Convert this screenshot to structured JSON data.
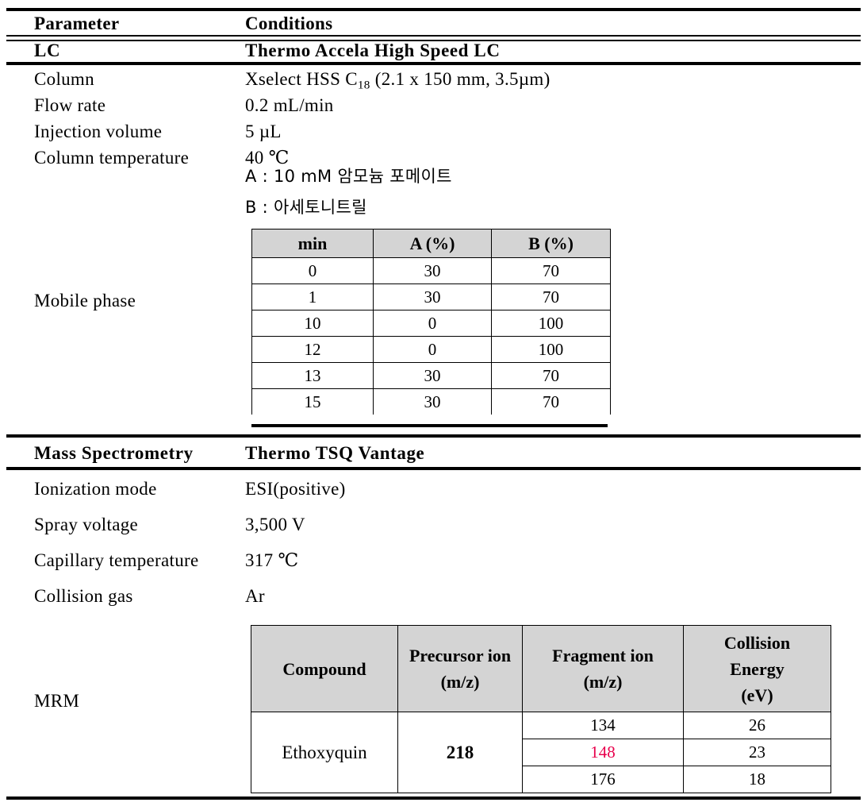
{
  "colors": {
    "rule": "#000000",
    "header_fill": "#d4d4d4",
    "highlight": "#e8004c"
  },
  "table_header": {
    "parameter": "Parameter",
    "conditions": "Conditions"
  },
  "lc_section": {
    "title": "LC",
    "instrument": "Thermo Accela High Speed LC",
    "rows": [
      {
        "label": "Column",
        "value_pre": "Xselect HSS C",
        "value_sub": "18",
        "value_post": " (2.1 x 150 mm, 3.5µm)"
      },
      {
        "label": "Flow rate",
        "value": "0.2 mL/min"
      },
      {
        "label": "Injection volume",
        "value": "5 µL"
      },
      {
        "label": "Column temperature",
        "value": "40 ℃"
      }
    ],
    "mobile_phase": {
      "label": "Mobile phase",
      "solvent_a": "A : 10 mM 암모늄 포메이트",
      "solvent_b": "B : 아세토니트릴",
      "gradient_headers": [
        "min",
        "A (%)",
        "B (%)"
      ],
      "gradient_rows": [
        [
          "0",
          "30",
          "70"
        ],
        [
          "1",
          "30",
          "70"
        ],
        [
          "10",
          "0",
          "100"
        ],
        [
          "12",
          "0",
          "100"
        ],
        [
          "13",
          "30",
          "70"
        ],
        [
          "15",
          "30",
          "70"
        ]
      ]
    }
  },
  "ms_section": {
    "title": "Mass Spectrometry",
    "instrument": "Thermo TSQ Vantage",
    "rows": [
      {
        "label": "Ionization mode",
        "value": "ESI(positive)"
      },
      {
        "label": "Spray voltage",
        "value": "3,500 V"
      },
      {
        "label": "Capillary temperature",
        "value": "317 ℃"
      },
      {
        "label": "Collision gas",
        "value": "Ar"
      }
    ],
    "mrm": {
      "label": "MRM",
      "headers": [
        {
          "line1": "Compound",
          "line2": ""
        },
        {
          "line1": "Precursor ion",
          "line2": "(m/z)"
        },
        {
          "line1": "Fragment ion",
          "line2": "(m/z)"
        },
        {
          "line1": "Collision",
          "line2": "Energy",
          "line3": "(eV)"
        }
      ],
      "compound": "Ethoxyquin",
      "precursor_ion": "218",
      "transitions": [
        {
          "fragment": "134",
          "energy": "26",
          "highlight": false
        },
        {
          "fragment": "148",
          "energy": "23",
          "highlight": true
        },
        {
          "fragment": "176",
          "energy": "18",
          "highlight": false
        }
      ]
    }
  }
}
